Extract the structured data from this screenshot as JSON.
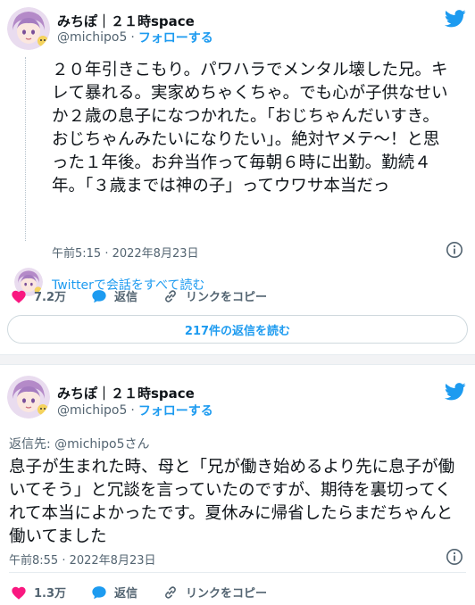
{
  "tweet1": {
    "display_name": "みちぽ｜２１時space",
    "handle": "@michipo5",
    "separator": "·",
    "follow_label": "フォローする",
    "text": "２０年引きこもり。パワハラでメンタル壊した兄。キレて暴れる。実家めちゃくちゃ。でも心が子供なせいか２歳の息子になつかれた。「おじちゃんだいすき。おじちゃんみたいになりたい」。絶対ヤメテ～！と思った１年後。お弁当作って毎朝６時に出勤。勤続４年。「３歳までは神の子」ってウワサ本当だっ",
    "timestamp": "午前5:15 · 2022年8月23日",
    "read_conversation": "Twitterで会話をすべて読む",
    "likes": "7.2万",
    "reply_label": "返信",
    "copy_link_label": "リンクをコピー",
    "read_replies": "217件の返信を読む"
  },
  "tweet2": {
    "display_name": "みちぽ｜２１時space",
    "handle": "@michipo5",
    "separator": "·",
    "follow_label": "フォローする",
    "reply_to": "返信先: @michipo5さん",
    "text": "息子が生まれた時、母と「兄が働き始めるより先に息子が働いてそう」と冗談を言っていたのですが、期待を裏切ってくれて本当によかったです。夏休みに帰省したらまだちゃんと働いてました",
    "timestamp": "午前8:55 · 2022年8月23日",
    "likes": "1.3万",
    "reply_label": "返信",
    "copy_link_label": "リンクをコピー"
  },
  "colors": {
    "accent": "#1d9bf0",
    "like": "#f91880",
    "muted": "#536471"
  },
  "icons": [
    "avatar",
    "twitter-bird-icon",
    "info-icon",
    "heart-icon",
    "reply-bubble-icon",
    "link-icon"
  ]
}
